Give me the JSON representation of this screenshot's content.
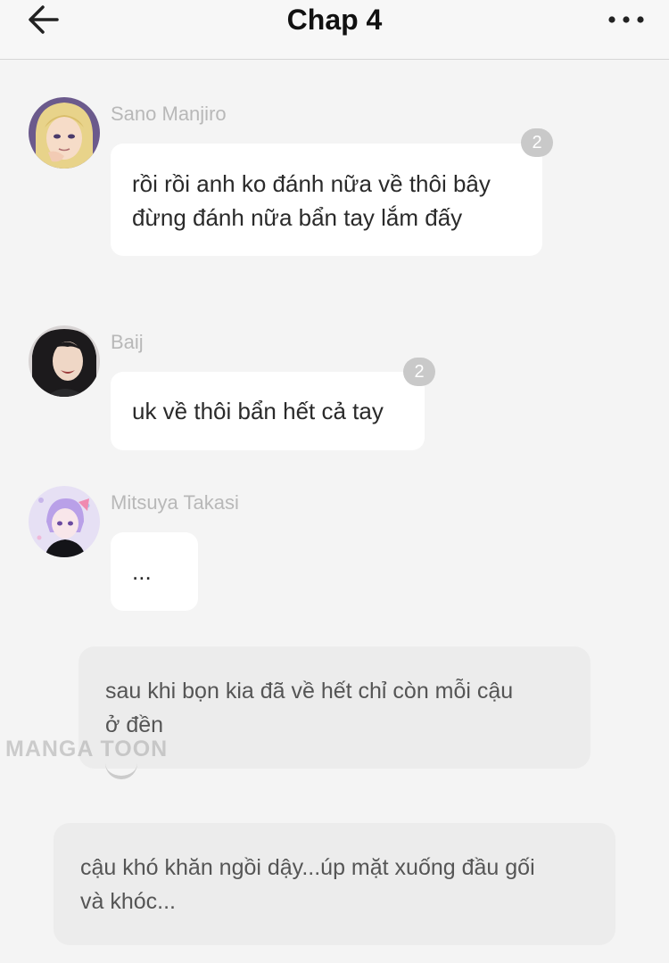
{
  "header": {
    "title": "Chap 4",
    "back_icon": "arrow-left-icon",
    "more_icon": "more-horizontal-icon"
  },
  "messages": [
    {
      "name": "Sano Manjiro",
      "text_lines": [
        "rồi rồi anh ko đánh nữa về thôi bây",
        "đừng đánh nữa bẩn tay lắm đấy"
      ],
      "badge": "2",
      "avatar": "avatar-image"
    },
    {
      "name": "Baij",
      "text_lines": [
        "uk về thôi bẩn hết cả tay"
      ],
      "badge": "2",
      "avatar": "avatar-image"
    },
    {
      "name": "Mitsuya Takasi",
      "text_lines": [
        "..."
      ],
      "avatar": "avatar-image"
    }
  ],
  "narrations": [
    {
      "text_lines": [
        "sau khi bọn kia đã về hết chỉ còn mỗi cậu",
        "ở đền"
      ]
    },
    {
      "text_lines": [
        "cậu khó khăn ngồi dậy...úp mặt xuống đầu gối",
        "và khóc..."
      ]
    }
  ],
  "watermark": "MANGA TOON",
  "colors": {
    "background": "#f4f4f4",
    "bubble": "#ffffff",
    "narration": "#ececec",
    "badge": "#c9c9c9",
    "name": "#b8b8b8"
  }
}
